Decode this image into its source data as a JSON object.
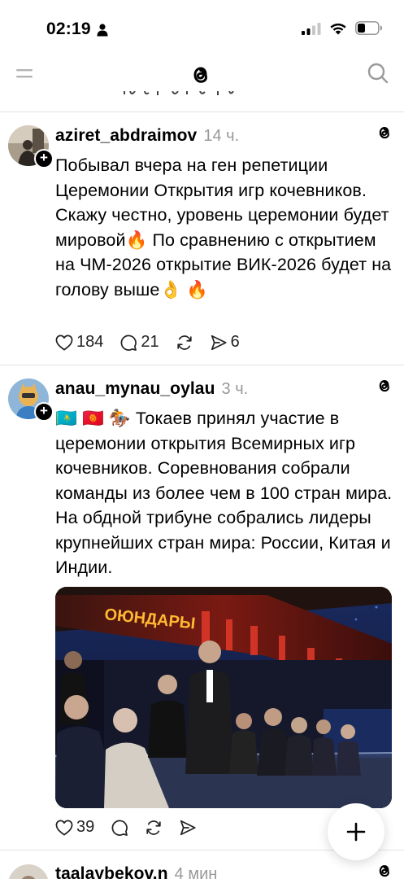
{
  "status_bar": {
    "time": "02:19",
    "person_icon": "person-icon",
    "signal_icon": "cellular-signal-icon",
    "wifi_icon": "wifi-icon",
    "battery_icon": "battery-icon"
  },
  "top_bar": {
    "menu_icon": "menu-icon",
    "logo_icon": "threads-logo-icon",
    "search_icon": "search-icon"
  },
  "posts": [
    {
      "username": "aziret_abdraimov",
      "time": "14 ч.",
      "text": "Побывал вчера на ген репетиции Церемонии Открытия игр кочевников. Скажу честно, уровень церемонии будет мировой🔥 По сравнению с открытием на ЧМ-2026 открытие ВИК-2026 будет на голову выше👌 🔥",
      "likes": "184",
      "replies": "21",
      "shares": "6"
    },
    {
      "username": "anau_mynau_oylau",
      "time": "3 ч.",
      "text": "🇰🇿 🇰🇬 🏇 Токаев принял участие в церемонии открытия Всемирных игр кочевников. Соревнования собрали команды из более чем в 100 стран мира. На обдной трибуне собрались лидеры крупнейших стран мира: России, Китая и Индии.",
      "likes": "39",
      "photo_banner_text": "ОЮНДАРЫ"
    },
    {
      "username": "taalaybekov.n",
      "time": "4 мин"
    }
  ],
  "colors": {
    "accent": "#000000",
    "muted": "#999999",
    "divider": "#e3e3e3"
  }
}
